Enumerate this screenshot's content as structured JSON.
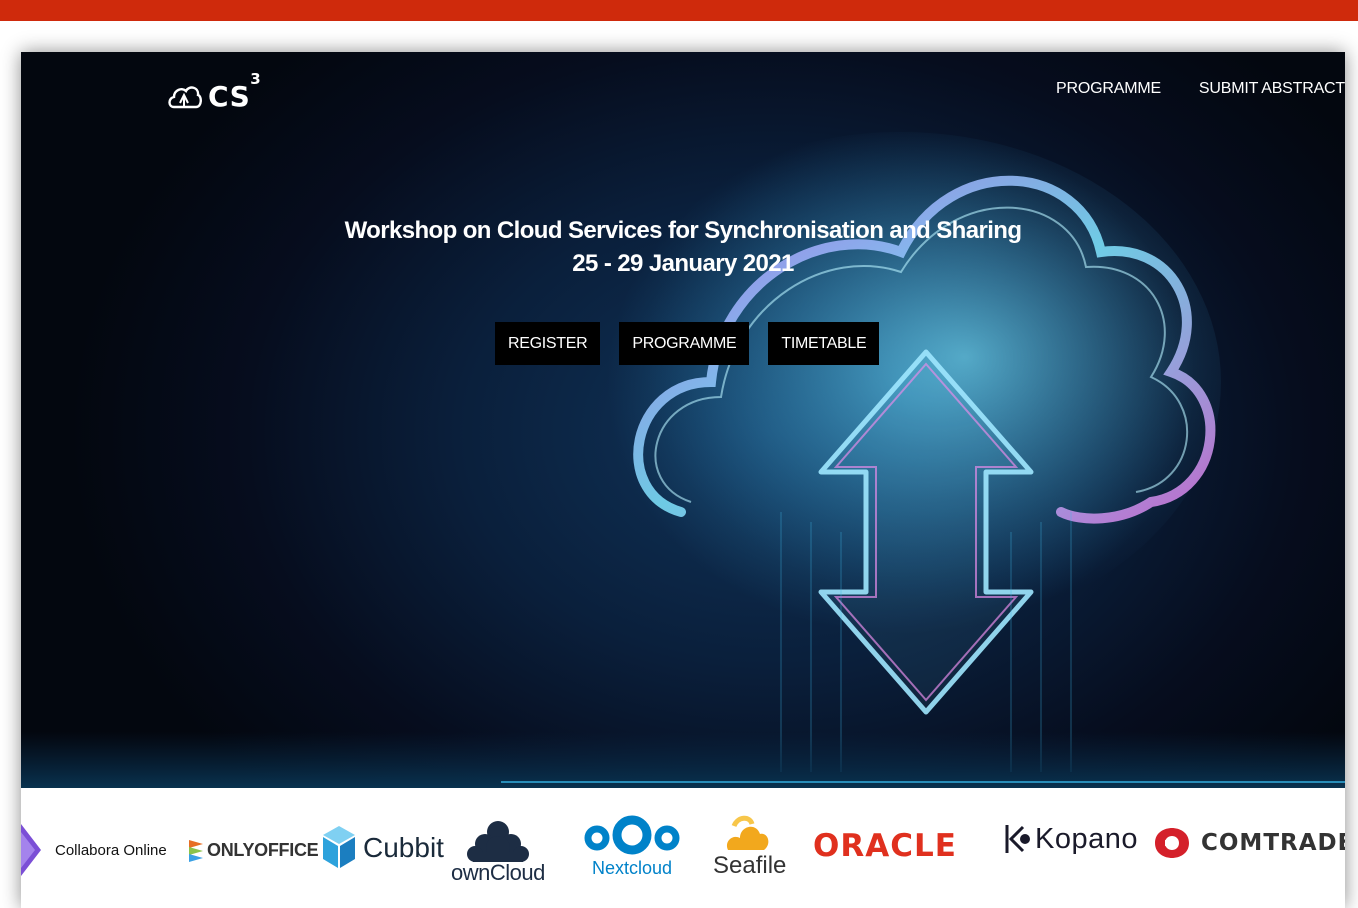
{
  "header": {
    "logo_text": "CS",
    "logo_sup": "3",
    "nav": [
      "PROGRAMME",
      "SUBMIT ABSTRACT"
    ]
  },
  "hero": {
    "title": "Workshop on Cloud Services for Synchronisation and Sharing",
    "dates": "25 - 29 January 2021",
    "buttons": [
      "REGISTER",
      "PROGRAMME",
      "TIMETABLE"
    ]
  },
  "partners": [
    {
      "name": "Collabora Online",
      "icon": "collabora-icon"
    },
    {
      "name": "ONLYOFFICE",
      "icon": "onlyoffice-icon"
    },
    {
      "name": "Cubbit",
      "icon": "cubbit-icon"
    },
    {
      "name": "ownCloud",
      "icon": "owncloud-icon"
    },
    {
      "name": "Nextcloud",
      "icon": "nextcloud-icon"
    },
    {
      "name": "Seafile",
      "icon": "seafile-icon"
    },
    {
      "name": "ORACLE",
      "icon": "oracle-icon"
    },
    {
      "name": "Kopano",
      "icon": "kopano-icon"
    },
    {
      "name": "COMTRADE",
      "icon": "comtrade-icon"
    }
  ],
  "colors": {
    "top_bar": "#cf2a0c",
    "button_bg": "#000000",
    "oracle_red": "#e0301e",
    "nextcloud_blue": "#0082c9",
    "comtrade_red": "#d4202a",
    "onlyoffice_orange": "#e76e25",
    "cubbit_blue": "#2da2dc",
    "seafile_yellow": "#f2a81d"
  }
}
